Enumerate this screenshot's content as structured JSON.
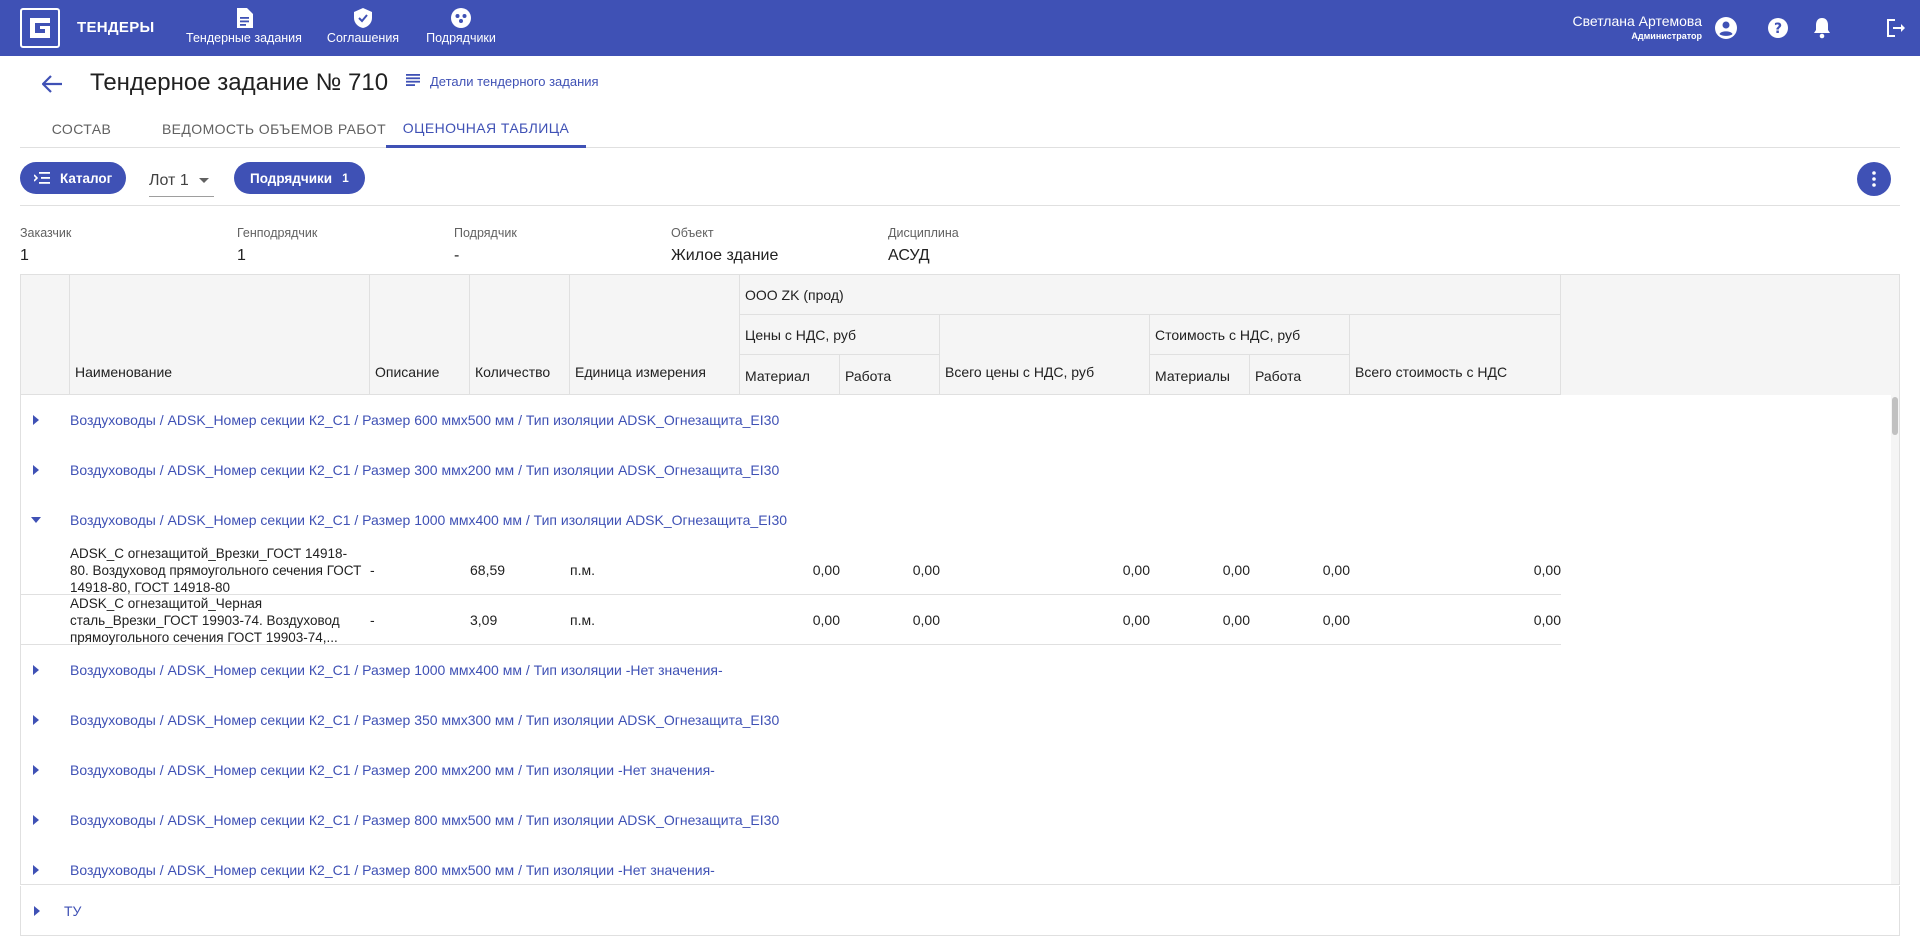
{
  "app": {
    "brand": "ТЕНДЕРЫ",
    "nav": [
      {
        "label": "Тендерные задания",
        "icon": "document-icon"
      },
      {
        "label": "Соглашения",
        "icon": "shield-check-icon"
      },
      {
        "label": "Подрядчики",
        "icon": "team-icon"
      }
    ],
    "user": {
      "name": "Светлана Артемова",
      "role": "Администратор"
    },
    "colors": {
      "primary": "#3f51b5",
      "text": "#212121",
      "muted": "#616161",
      "header_bg": "#f5f5f5",
      "border": "#e0e0e0"
    }
  },
  "header": {
    "title": "Тендерное задание № 710",
    "details_link": "Детали тендерного задания"
  },
  "tabs": [
    {
      "label": "СОСТАВ",
      "active": false
    },
    {
      "label": "ВЕДОМОСТЬ ОБЪЕМОВ РАБОТ",
      "active": false
    },
    {
      "label": "ОЦЕНОЧНАЯ ТАБЛИЦА",
      "active": true
    }
  ],
  "toolbar": {
    "catalog_label": "Каталог",
    "lot_value": "Лот 1",
    "contractors_label": "Подрядчики",
    "contractors_count": "1"
  },
  "info": [
    {
      "label": "Заказчик",
      "value": "1"
    },
    {
      "label": "Генподрядчик",
      "value": "1"
    },
    {
      "label": "Подрядчик",
      "value": "-"
    },
    {
      "label": "Объект",
      "value": "Жилое здание"
    },
    {
      "label": "Дисциплина",
      "value": "АСУД"
    }
  ],
  "table": {
    "headers": {
      "name": "Наименование",
      "description": "Описание",
      "quantity": "Количество",
      "unit": "Единица измерения",
      "contractor": "ООО ZK (прод)",
      "prices_vat": "Цены с НДС, руб",
      "material": "Материал",
      "work": "Работа",
      "total_prices_vat": "Всего цены с НДС, руб",
      "cost_vat": "Стоимость с НДС, руб",
      "materials": "Материалы",
      "work2": "Работа",
      "total_cost_vat": "Всего стоимость с НДС"
    },
    "groups": [
      {
        "label": "Воздуховоды / ADSK_Номер секции К2_С1 / Размер 600 ммx500 мм / Тип изоляции ADSK_Огнезащита_EI30",
        "expanded": false
      },
      {
        "label": "Воздуховоды / ADSK_Номер секции К2_С1 / Размер 300 ммx200 мм / Тип изоляции ADSK_Огнезащита_EI30",
        "expanded": false
      },
      {
        "label": "Воздуховоды / ADSK_Номер секции К2_С1 / Размер 1000 ммx400 мм / Тип изоляции ADSK_Огнезащита_EI30",
        "expanded": true
      },
      {
        "label": "Воздуховоды / ADSK_Номер секции К2_С1 / Размер 1000 ммx400 мм / Тип изоляции -Нет значения-",
        "expanded": false
      },
      {
        "label": "Воздуховоды / ADSK_Номер секции К2_С1 / Размер 350 ммx300 мм / Тип изоляции ADSK_Огнезащита_EI30",
        "expanded": false
      },
      {
        "label": "Воздуховоды / ADSK_Номер секции К2_С1 / Размер 200 ммx200 мм / Тип изоляции -Нет значения-",
        "expanded": false
      },
      {
        "label": "Воздуховоды / ADSK_Номер секции К2_С1 / Размер 800 ммx500 мм / Тип изоляции ADSK_Огнезащита_EI30",
        "expanded": false
      },
      {
        "label": "Воздуховоды / ADSK_Номер секции К2_С1 / Размер 800 ммx500 мм / Тип изоляции -Нет значения-",
        "expanded": false
      }
    ],
    "items": [
      {
        "name": "ADSK_С огнезащитой_Врезки_ГОСТ 14918-80. Воздуховод прямоугольного сечения ГОСТ 14918-80, ГОСТ 14918-80",
        "description": "-",
        "quantity": "68,59",
        "unit": "п.м.",
        "material": "0,00",
        "work": "0,00",
        "total_prices": "0,00",
        "materials": "0,00",
        "work2": "0,00",
        "total_cost": "0,00"
      },
      {
        "name": "ADSK_С огнезащитой_Черная сталь_Врезки_ГОСТ 19903-74. Воздуховод прямоугольного сечения ГОСТ 19903-74,...",
        "description": "-",
        "quantity": "3,09",
        "unit": "п.м.",
        "material": "0,00",
        "work": "0,00",
        "total_prices": "0,00",
        "materials": "0,00",
        "work2": "0,00",
        "total_cost": "0,00"
      }
    ],
    "footer_group": "ТУ"
  }
}
